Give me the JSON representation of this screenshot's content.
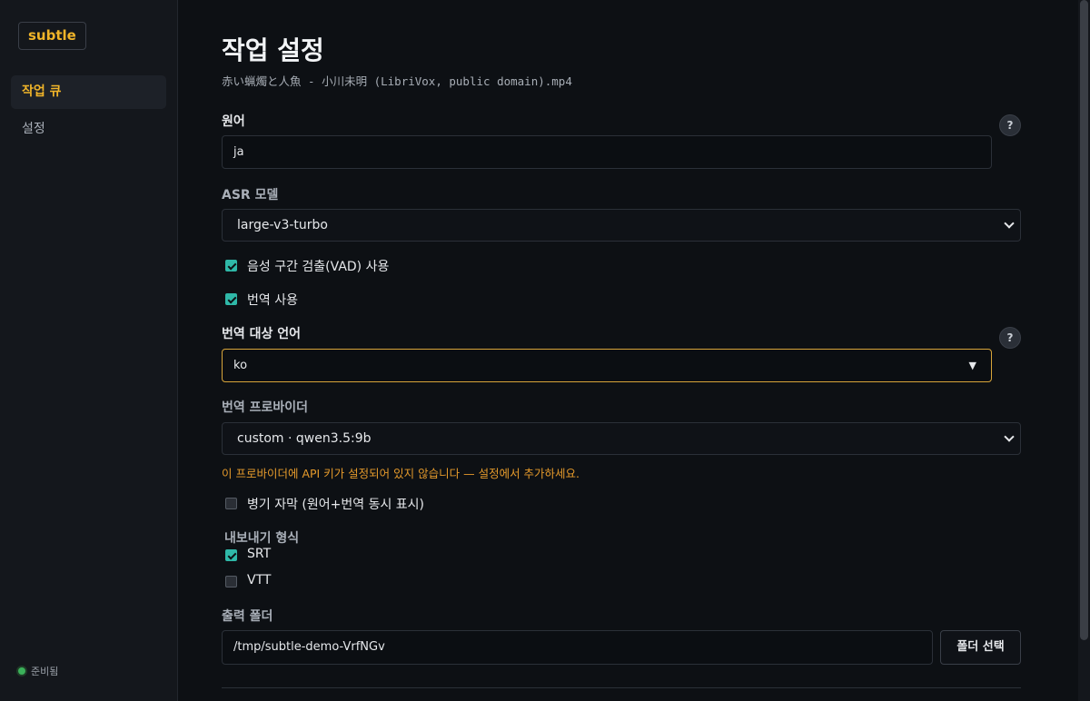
{
  "sidebar": {
    "logo": "subtle",
    "items": [
      {
        "label": "작업 큐",
        "active": true
      },
      {
        "label": "설정",
        "active": false
      }
    ],
    "status_label": "준비됨"
  },
  "main": {
    "title": "작업 설정",
    "filename": "赤い蝋燭と人魚 - 小川未明 (LibriVox, public domain).mp4",
    "source_lang": {
      "label": "원어",
      "value": "ja",
      "help_icon": "?"
    },
    "asr_model": {
      "label": "ASR 모델",
      "value": "large-v3-turbo"
    },
    "vad": {
      "label": "음성 구간 검출(VAD) 사용",
      "checked": true
    },
    "translate": {
      "label": "번역 사용",
      "checked": true
    },
    "target_lang": {
      "label": "번역 대상 언어",
      "value": "ko",
      "help_icon": "?"
    },
    "provider": {
      "label": "번역 프로바이더",
      "value": "custom · qwen3.5:9b",
      "warning": "이 프로바이더에 API 키가 설정되어 있지 않습니다 — 설정에서 추가하세요."
    },
    "bilingual": {
      "label": "병기 자막 (원어+번역 동시 표시)",
      "checked": false
    },
    "export": {
      "label": "내보내기 형식",
      "formats": [
        {
          "label": "SRT",
          "checked": true
        },
        {
          "label": "VTT",
          "checked": false
        }
      ]
    },
    "output": {
      "label": "출력 폴더",
      "value": "/tmp/subtle-demo-VrfNGv",
      "button": "폴더 선택"
    }
  },
  "colors": {
    "accent": "#f0b429",
    "check": "#2fb8a8",
    "warning": "#e59a2b",
    "status": "#3bb15a"
  }
}
